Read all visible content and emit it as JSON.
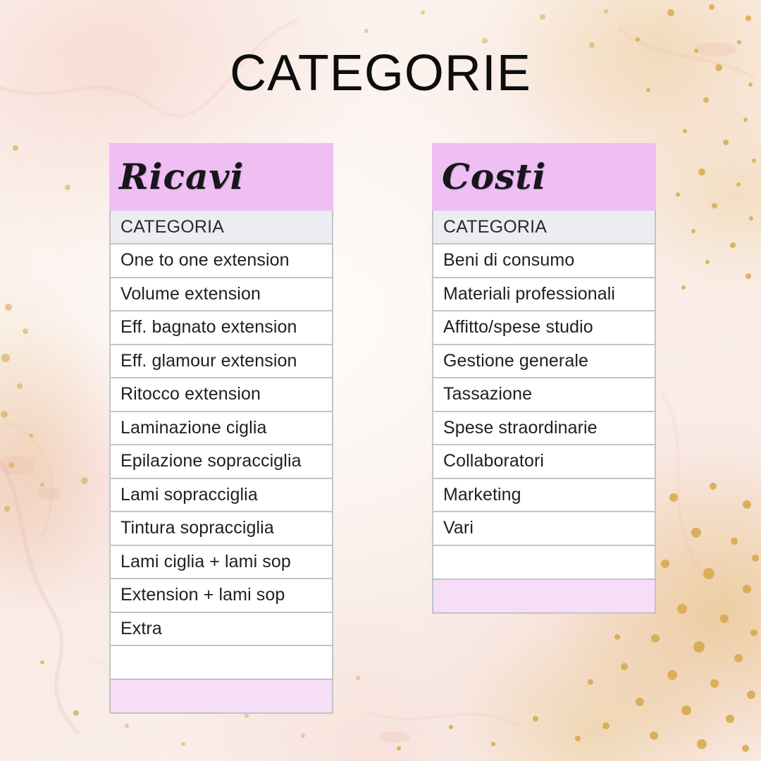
{
  "page": {
    "title": "CATEGORIE",
    "background_style": "blush pink watercolor marble with gold foil flecks",
    "colors": {
      "background": "#faeee8",
      "title_text": "#0d0d0d",
      "table_header_pink": "#efbff4",
      "table_footer_pink": "#f6ddf8",
      "column_header_gray": "#ebedf1",
      "cell_background": "#ffffff",
      "cell_border": "#c2c4c6",
      "cell_text": "#1f1f22",
      "gold_fleck": "#e0ba62"
    }
  },
  "tables": [
    {
      "id": "ricavi",
      "title": "Ricavi",
      "column_header": "CATEGORIA",
      "rows": [
        "One to one extension",
        "Volume extension",
        "Eff. bagnato extension",
        "Eff. glamour extension",
        "Ritocco extension",
        "Laminazione ciglia",
        "Epilazione sopracciglia",
        "Lami sopracciglia",
        "Tintura sopracciglia",
        "Lami ciglia + lami sop",
        "Extension + lami sop",
        "Extra",
        ""
      ]
    },
    {
      "id": "costi",
      "title": "Costi",
      "column_header": "CATEGORIA",
      "rows": [
        "Beni di consumo",
        "Materiali professionali",
        "Affitto/spese studio",
        "Gestione generale",
        "Tassazione",
        "Spese straordinarie",
        "Collaboratori",
        "Marketing",
        "Vari",
        ""
      ]
    }
  ]
}
